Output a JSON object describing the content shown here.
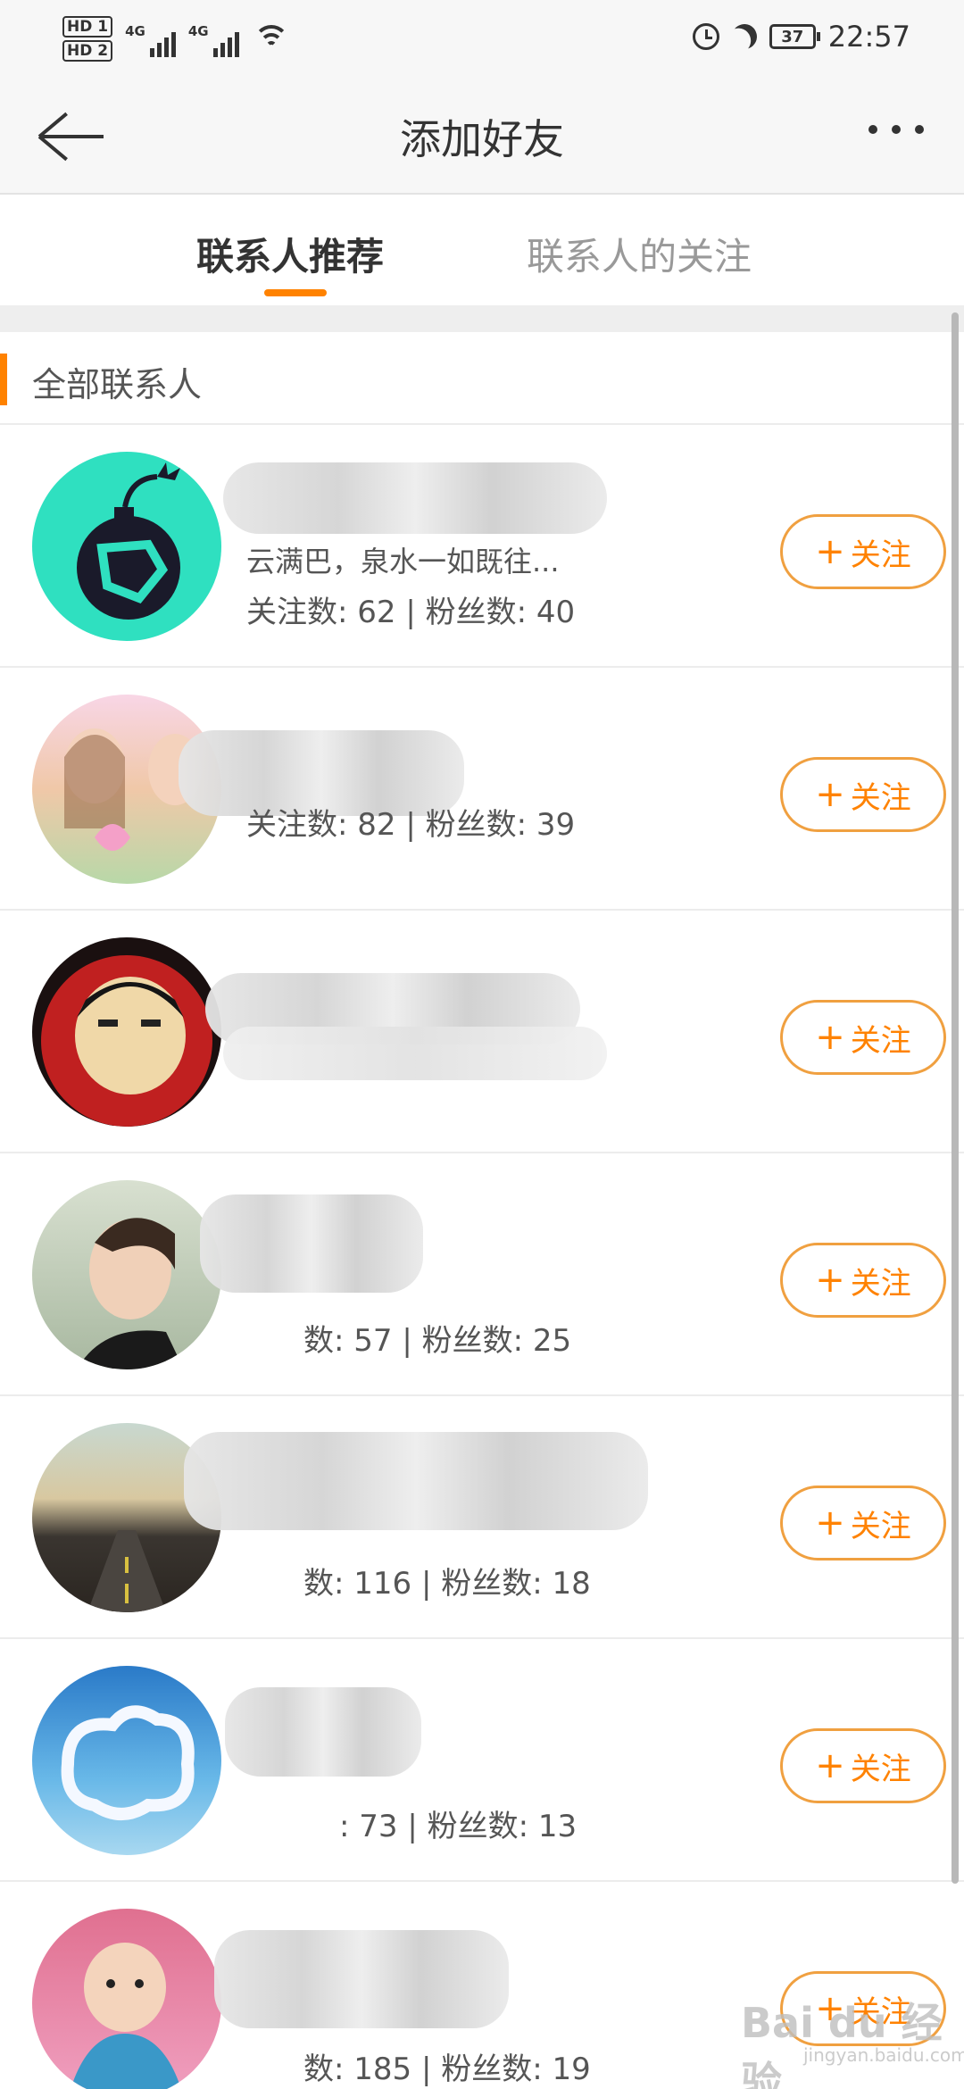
{
  "status_bar": {
    "hd1": "HD 1",
    "hd2": "HD 2",
    "net1": "4G",
    "net2": "4G",
    "battery": "37",
    "time": "22:57"
  },
  "nav": {
    "title": "添加好友",
    "back_icon": "back-arrow-icon",
    "more_icon": "more-dots-icon"
  },
  "tabs": [
    {
      "label": "联系人推荐",
      "active": true
    },
    {
      "label": "联系人的关注",
      "active": false
    }
  ],
  "section": {
    "title": "全部联系人"
  },
  "accent_color": "#ff8200",
  "contacts": [
    {
      "intro": "云满巴，泉水一如既往...",
      "stats": "关注数: 62 | 粉丝数: 40",
      "follow_label": "关注"
    },
    {
      "intro": "",
      "stats": "关注数: 82 | 粉丝数: 39",
      "follow_label": "关注"
    },
    {
      "intro": "",
      "stats": "",
      "follow_label": "关注"
    },
    {
      "intro": "",
      "stats": "数: 57 | 粉丝数: 25",
      "follow_label": "关注"
    },
    {
      "intro": "",
      "stats": "数: 116 | 粉丝数: 18",
      "follow_label": "关注"
    },
    {
      "intro": "",
      "stats": ": 73 | 粉丝数: 13",
      "follow_label": "关注"
    },
    {
      "intro": "",
      "stats": "数: 185 | 粉丝数: 19",
      "follow_label": "关注"
    }
  ],
  "watermark": {
    "text": "Bai du 经验",
    "sub": "jingyan.baidu.com"
  }
}
